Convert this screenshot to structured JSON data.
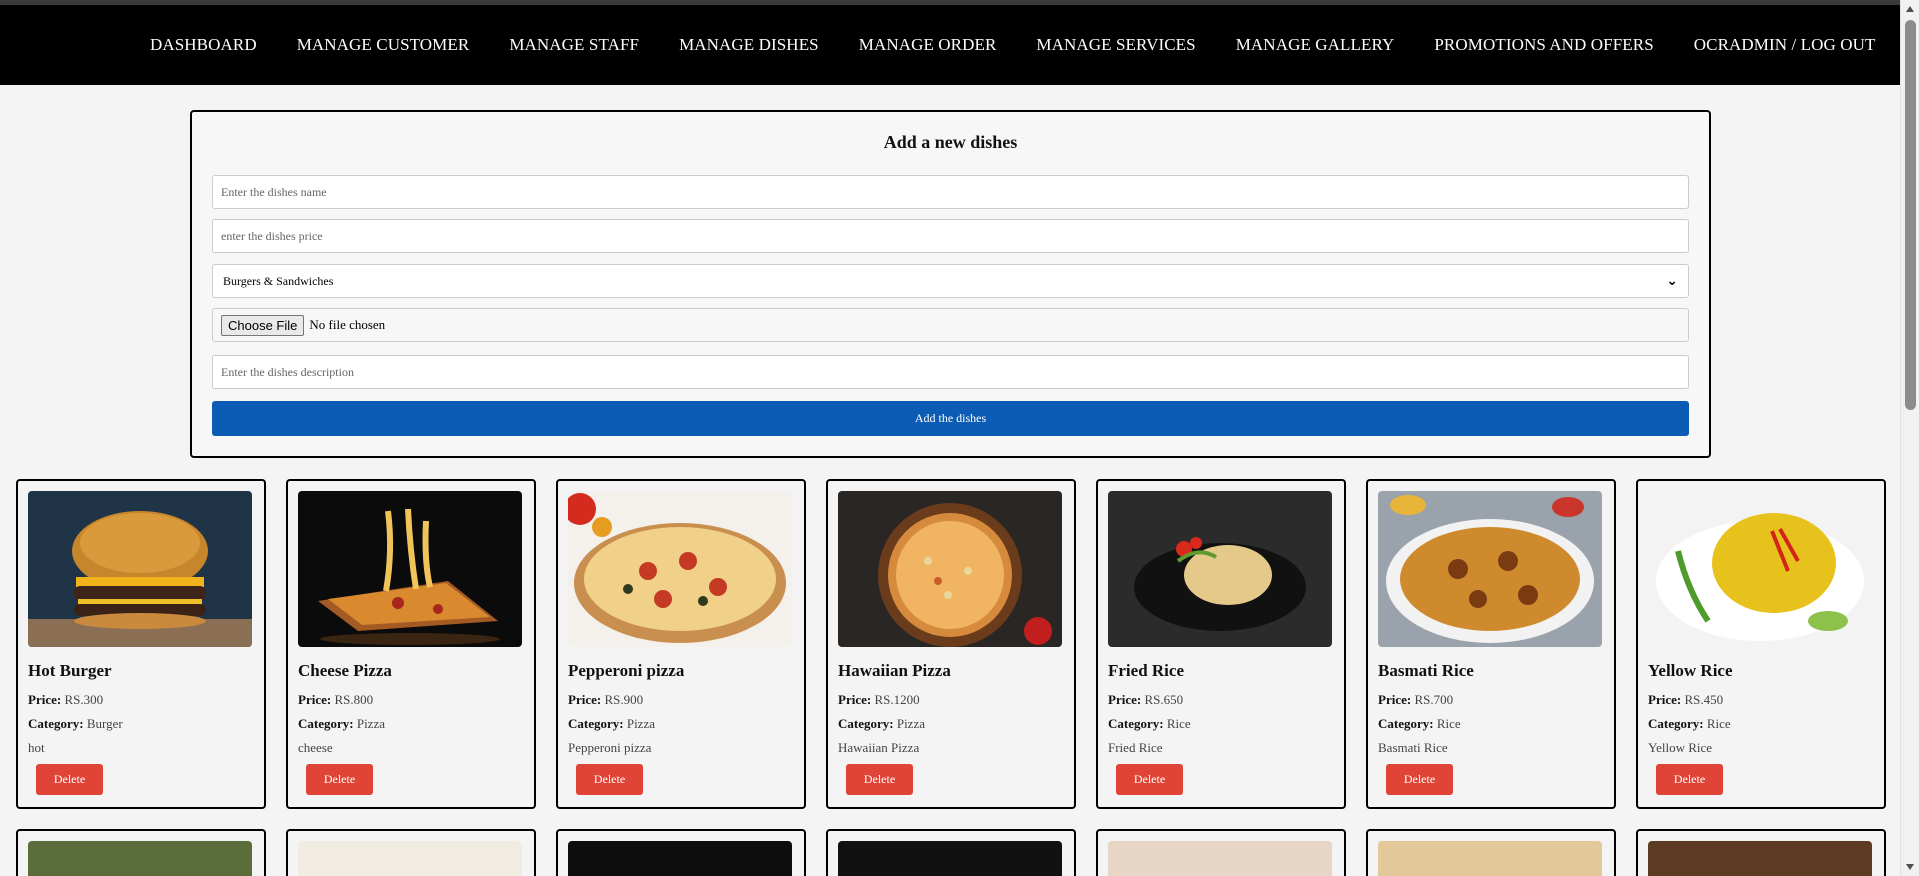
{
  "nav": {
    "items": [
      "DASHBOARD",
      "MANAGE CUSTOMER",
      "MANAGE STAFF",
      "MANAGE DISHES",
      "MANAGE ORDER",
      "MANAGE SERVICES",
      "MANAGE GALLERY",
      "PROMOTIONS AND OFFERS",
      "OCRADMIN / LOG OUT"
    ]
  },
  "form": {
    "title": "Add a new dishes",
    "name_placeholder": "Enter the dishes name",
    "price_placeholder": "enter the dishes price",
    "category_selected": "Burgers & Sandwiches",
    "choose_file_label": "Choose File",
    "file_status": "No file chosen",
    "description_placeholder": "Enter the dishes description",
    "submit_label": "Add the dishes"
  },
  "labels": {
    "price": "Price:",
    "category": "Category:",
    "delete": "Delete"
  },
  "dishes": [
    {
      "name": "Hot Burger",
      "price": "RS.300",
      "category": "Burger",
      "description": "hot"
    },
    {
      "name": "Cheese Pizza",
      "price": "RS.800",
      "category": "Pizza",
      "description": "cheese"
    },
    {
      "name": "Pepperoni pizza",
      "price": "RS.900",
      "category": "Pizza",
      "description": "Pepperoni pizza"
    },
    {
      "name": "Hawaiian Pizza",
      "price": "RS.1200",
      "category": "Pizza",
      "description": "Hawaiian Pizza"
    },
    {
      "name": "Fried Rice",
      "price": "RS.650",
      "category": "Rice",
      "description": "Fried Rice"
    },
    {
      "name": "Basmati Rice",
      "price": "RS.700",
      "category": "Rice",
      "description": "Basmati Rice"
    },
    {
      "name": "Yellow Rice",
      "price": "RS.450",
      "category": "Rice",
      "description": "Yellow Rice"
    }
  ],
  "colors": {
    "navbar": "#000000",
    "accent_blue": "#0c5bb4",
    "delete_red": "#e04437"
  }
}
